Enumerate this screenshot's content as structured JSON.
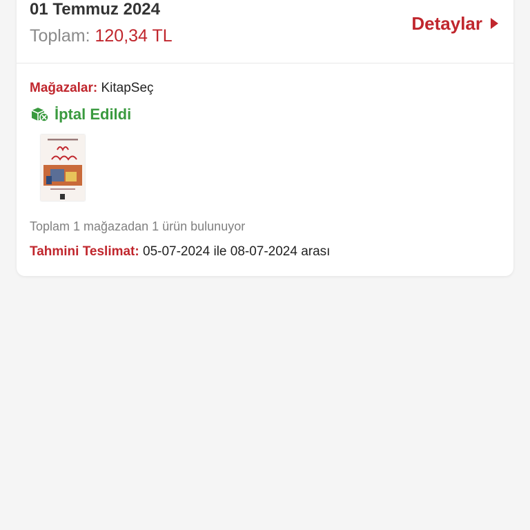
{
  "order": {
    "date": "01 Temmuz 2024",
    "total_label": "Toplam:",
    "total_amount": "120,34 TL",
    "details_label": "Detaylar"
  },
  "stores": {
    "label": "Mağazalar:",
    "value": "KitapSeç"
  },
  "status": {
    "label": "İptal Edildi",
    "icon": "package-cancel-icon",
    "color": "#3a9a3f"
  },
  "product": {
    "image": "book-cover-ruh-sagligi"
  },
  "summary": "Toplam 1 mağazadan 1 ürün bulunuyor",
  "delivery": {
    "label": "Tahmini Teslimat:",
    "value": "05-07-2024 ile 08-07-2024 arası"
  },
  "colors": {
    "accent": "#c0262d",
    "success": "#3a9a3f",
    "background": "#f5f5f5"
  }
}
